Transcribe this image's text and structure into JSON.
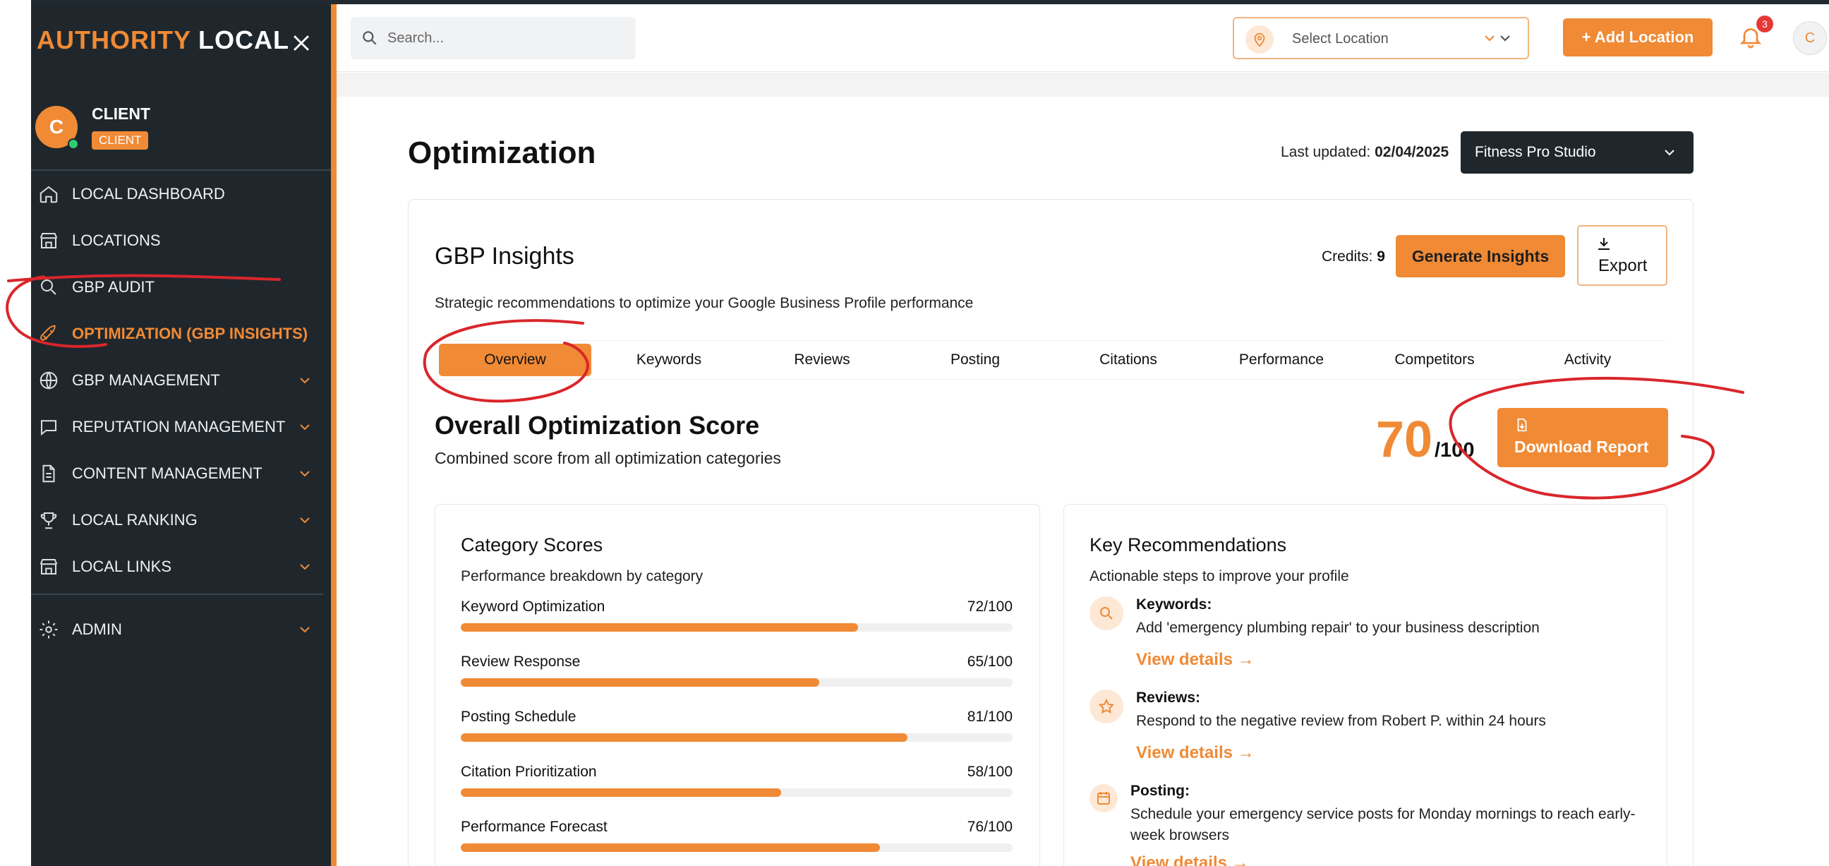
{
  "brand": {
    "part1": "AUTHORITY",
    "part2": "LOCAL"
  },
  "user": {
    "initial": "C",
    "name": "CLIENT",
    "role": "CLIENT"
  },
  "sidebar": {
    "items": [
      {
        "label": "LOCAL DASHBOARD",
        "icon": "home-icon"
      },
      {
        "label": "LOCATIONS",
        "icon": "store-icon"
      },
      {
        "label": "GBP AUDIT",
        "icon": "search-icon"
      },
      {
        "label": "OPTIMIZATION (GBP INSIGHTS)",
        "icon": "rocket-icon",
        "active": true
      },
      {
        "label": "GBP MANAGEMENT",
        "icon": "globe-icon"
      },
      {
        "label": "REPUTATION MANAGEMENT",
        "icon": "chat-icon"
      },
      {
        "label": "CONTENT MANAGEMENT",
        "icon": "document-icon"
      },
      {
        "label": "LOCAL RANKING",
        "icon": "trophy-icon"
      },
      {
        "label": "LOCAL LINKS",
        "icon": "store-icon"
      },
      {
        "label": "ADMIN",
        "icon": "gear-icon"
      }
    ]
  },
  "header": {
    "search_placeholder": "Search...",
    "location_placeholder": "Select Location",
    "add_location": "+ Add Location",
    "notification_count": "3",
    "avatar_initial": "C"
  },
  "page": {
    "title": "Optimization",
    "last_updated_label": "Last updated:",
    "last_updated_value": "02/04/2025",
    "business": "Fitness Pro Studio"
  },
  "insights": {
    "title": "GBP Insights",
    "credits_label": "Credits:",
    "credits_value": "9",
    "generate_label": "Generate Insights",
    "export_label": "Export",
    "subtitle": "Strategic recommendations to optimize your Google Business Profile performance",
    "tabs": [
      "Overview",
      "Keywords",
      "Reviews",
      "Posting",
      "Citations",
      "Performance",
      "Competitors",
      "Activity"
    ],
    "active_tab": "Overview"
  },
  "score": {
    "title": "Overall Optimization Score",
    "subtitle": "Combined score from all optimization categories",
    "value": "70",
    "max": "/100",
    "download_label": "Download Report"
  },
  "categories": {
    "title": "Category Scores",
    "subtitle": "Performance breakdown by category",
    "items": [
      {
        "name": "Keyword Optimization",
        "score": "72/100",
        "value": 72
      },
      {
        "name": "Review Response",
        "score": "65/100",
        "value": 65
      },
      {
        "name": "Posting Schedule",
        "score": "81/100",
        "value": 81
      },
      {
        "name": "Citation Prioritization",
        "score": "58/100",
        "value": 58
      },
      {
        "name": "Performance Forecast",
        "score": "76/100",
        "value": 76
      }
    ]
  },
  "recommendations": {
    "title": "Key Recommendations",
    "subtitle": "Actionable steps to improve your profile",
    "link_label": "View details →",
    "items": [
      {
        "category": "Keywords:",
        "text": "Add 'emergency plumbing repair' to your business description",
        "icon": "search-icon"
      },
      {
        "category": "Reviews:",
        "text": "Respond to the negative review from Robert P. within 24 hours",
        "icon": "star-icon"
      },
      {
        "category": "Posting:",
        "text": "Schedule your emergency service posts for Monday mornings to reach early-week browsers",
        "icon": "calendar-icon"
      }
    ]
  },
  "colors": {
    "accent": "#f08a35",
    "sidebar": "#1f272d",
    "annotation": "#d9262b"
  }
}
